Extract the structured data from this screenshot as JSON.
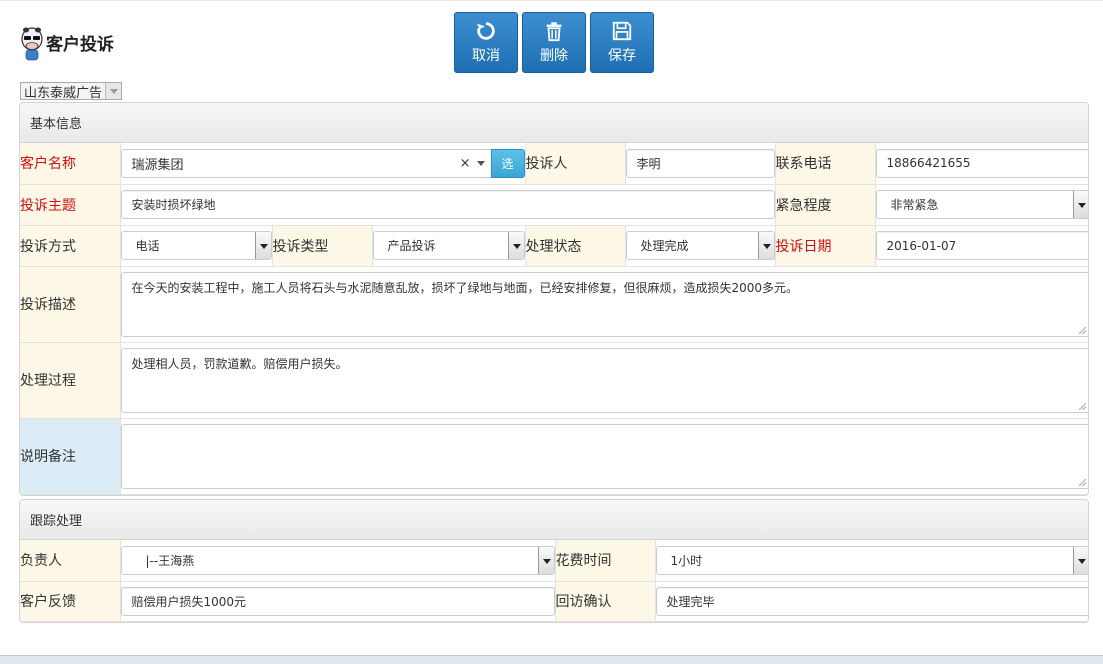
{
  "header": {
    "title": "客户投诉"
  },
  "toolbar": {
    "cancel": "取消",
    "delete": "删除",
    "save": "保存"
  },
  "company": {
    "selected": "山东泰威广告"
  },
  "basic": {
    "section_title": "基本信息",
    "customer_name_label": "客户名称",
    "customer_name_value": "瑞源集团",
    "customer_clear": "×",
    "pick_label": "选",
    "complainant_label": "投诉人",
    "complainant_value": "李明",
    "phone_label": "联系电话",
    "phone_value": "18866421655",
    "subject_label": "投诉主题",
    "subject_value": "安装时损坏绿地",
    "urgency_label": "紧急程度",
    "urgency_value": "非常紧急",
    "method_label": "投诉方式",
    "method_value": "电话",
    "type_label": "投诉类型",
    "type_value": "产品投诉",
    "status_label": "处理状态",
    "status_value": "处理完成",
    "date_label": "投诉日期",
    "date_value": "2016-01-07",
    "desc_label": "投诉描述",
    "desc_value": "在今天的安装工程中，施工人员将石头与水泥随意乱放，损坏了绿地与地面，已经安排修复，但很麻烦，造成损失2000多元。",
    "process_label": "处理过程",
    "process_value": "处理相人员，罚款道歉。赔偿用户损失。",
    "remark_label": "说明备注",
    "remark_value": ""
  },
  "tracking": {
    "section_title": "跟踪处理",
    "owner_label": "负责人",
    "owner_value": "|--王海燕",
    "time_label": "花费时间",
    "time_value": "1小时",
    "feedback_label": "客户反馈",
    "feedback_value": "赔偿用户损失1000元",
    "revisit_label": "回访确认",
    "revisit_value": "处理完毕"
  },
  "colors": {
    "accent": "#2a7fc4",
    "required": "#d01010",
    "label_bg": "#fcf7e6"
  }
}
